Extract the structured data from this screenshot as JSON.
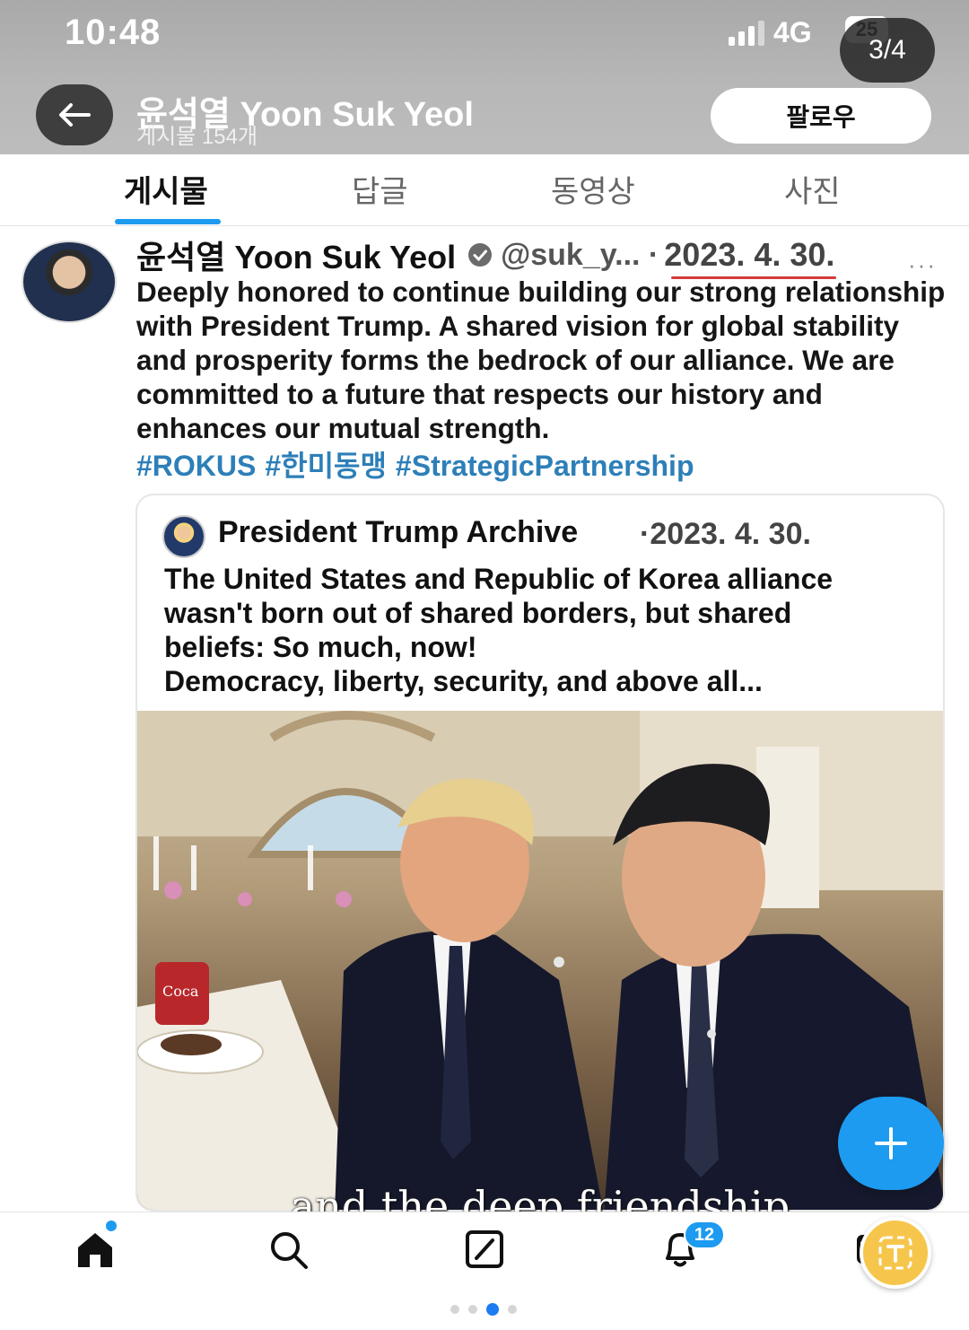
{
  "status_bar": {
    "time": "10:48",
    "network": "4G",
    "battery": "25",
    "page_counter": "3/4"
  },
  "header": {
    "profile_name": "윤석열 Yoon Suk Yeol",
    "post_count": "게시물 154개",
    "follow_label": "팔로우"
  },
  "tabs": [
    {
      "label": "게시물",
      "active": true
    },
    {
      "label": "답글",
      "active": false
    },
    {
      "label": "동영상",
      "active": false
    },
    {
      "label": "사진",
      "active": false
    }
  ],
  "tweet": {
    "author_name": "윤석열 Yoon Suk Yeol",
    "handle": "@suk_y... ·",
    "date": "2023. 4. 30.",
    "more": "···",
    "body": "Deeply honored to continue building our strong relationship with President Trump. A shared vision for global stability and prosperity forms the bedrock of our alliance. We are committed to a future that respects our history and enhances our mutual strength.",
    "hashtags": [
      "#ROKUS",
      "#한미동맹",
      "#StrategicPartnership"
    ]
  },
  "quoted_tweet": {
    "author_name": "President Trump Archive",
    "date": "·2023. 4. 30.",
    "body_lines": [
      "The United States and Republic of Korea alliance",
      "wasn't born out of shared borders, but shared",
      "beliefs: So much, now!",
      "Democracy, liberty, security, and above all..."
    ],
    "photo_caption": "and the deep friendship"
  },
  "bottom_nav": {
    "notification_count": "12"
  },
  "colors": {
    "accent": "#1d9bf0",
    "hashtag": "#2d7fb8",
    "date_underline": "#d43a3a"
  }
}
